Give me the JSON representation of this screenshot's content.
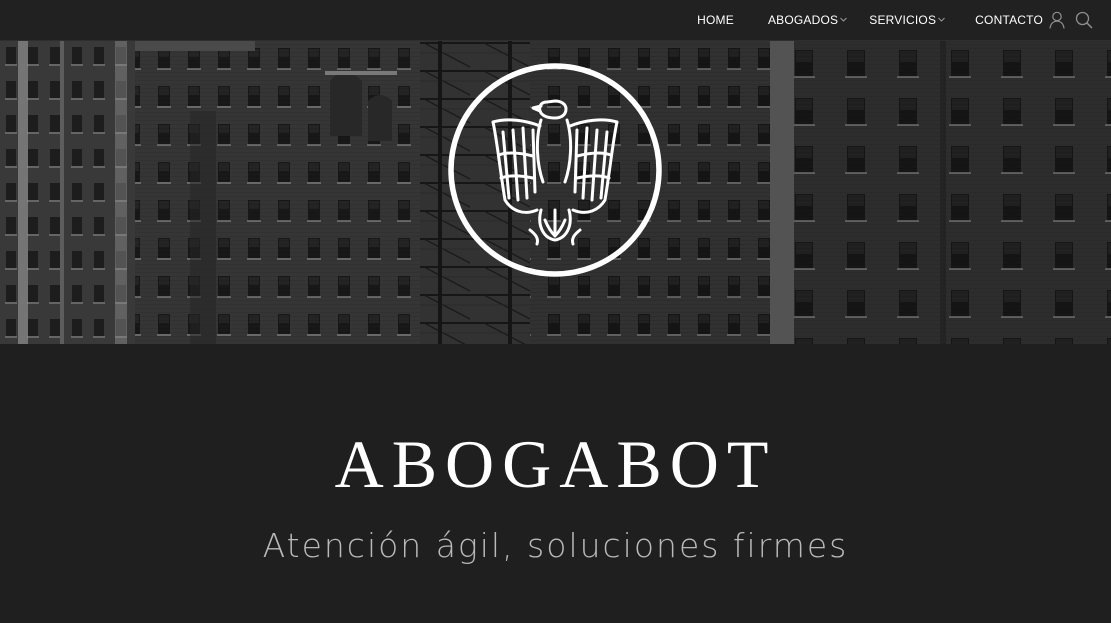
{
  "nav": {
    "items": [
      {
        "label": "HOME",
        "has_dropdown": false
      },
      {
        "label": "ABOGADOS",
        "has_dropdown": true
      },
      {
        "label": "SERVICIOS",
        "has_dropdown": true
      },
      {
        "label": "CONTACTO",
        "has_dropdown": false
      }
    ],
    "icons": [
      "user-icon",
      "search-icon"
    ]
  },
  "hero": {
    "background": "grayscale-city-buildings",
    "logo": "eagle-emblem"
  },
  "brand": {
    "title": "ABOGABOT",
    "tagline": "Atención ágil, soluciones firmes"
  },
  "colors": {
    "page_background": "#1f1f1f",
    "navbar_background": "#212121",
    "text_primary": "#ffffff",
    "text_secondary": "#b9b9b9"
  }
}
